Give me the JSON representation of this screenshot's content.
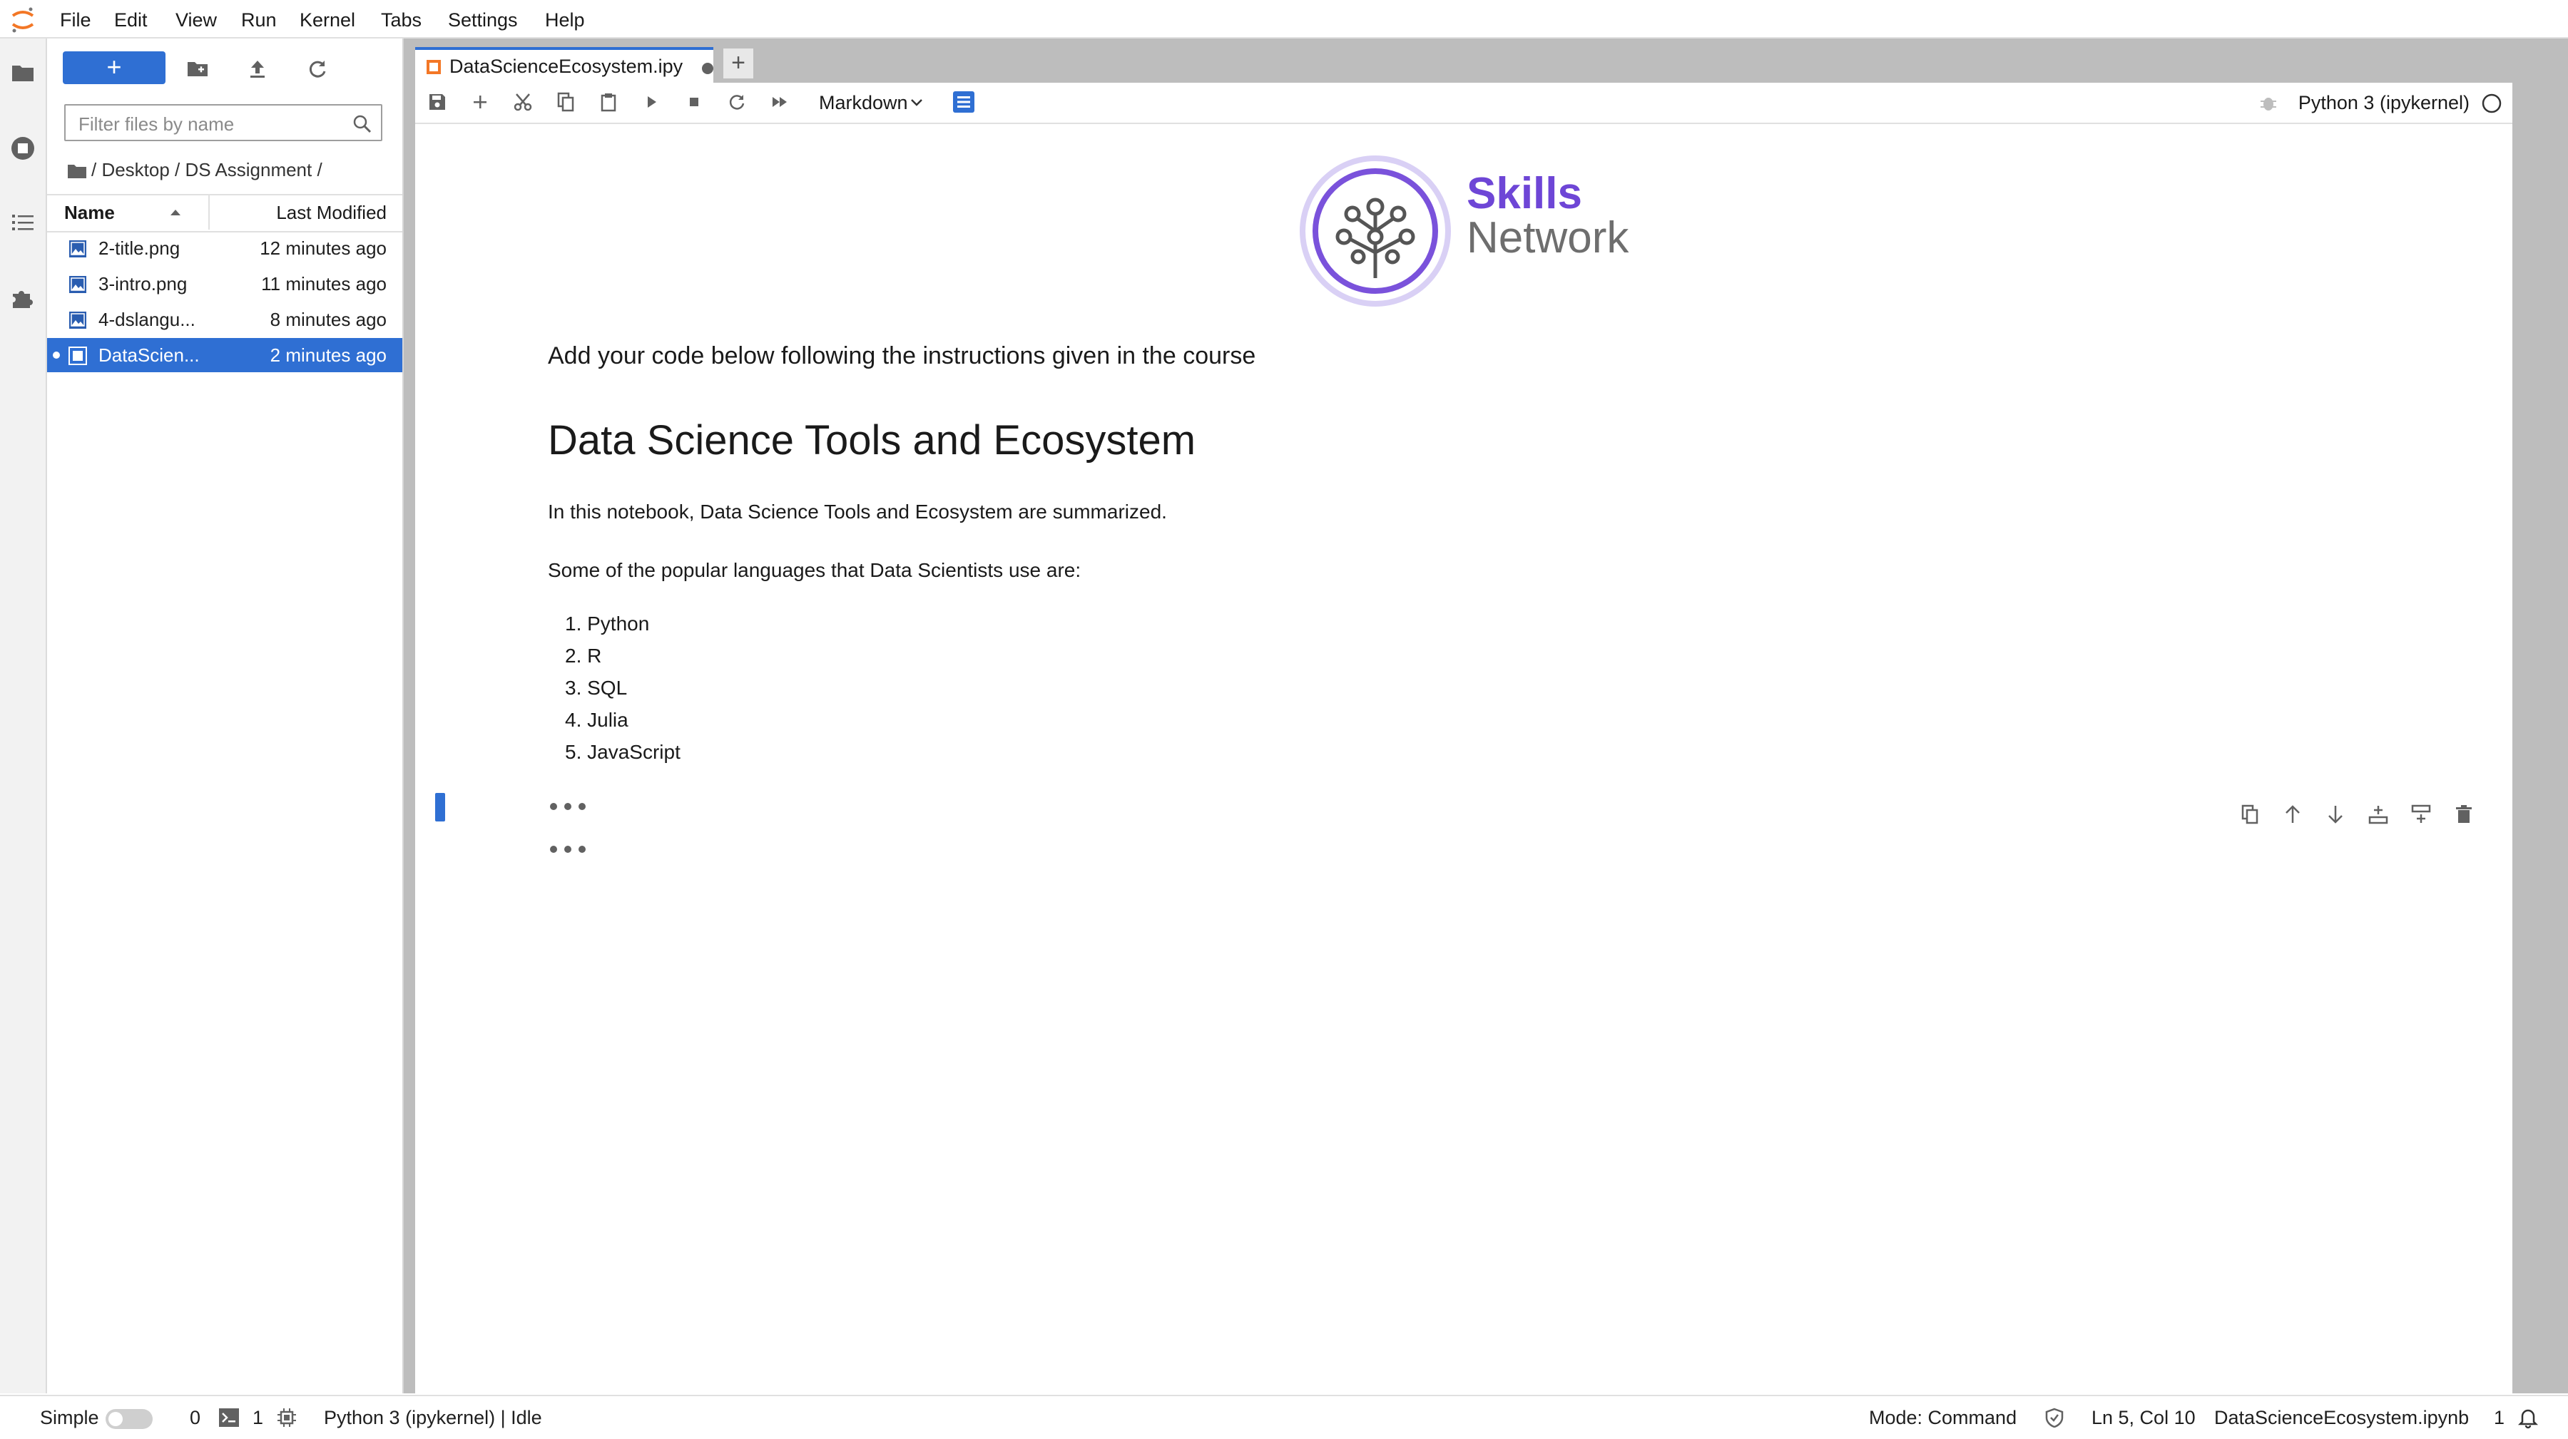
{
  "menu": {
    "items": [
      "File",
      "Edit",
      "View",
      "Run",
      "Kernel",
      "Tabs",
      "Settings",
      "Help"
    ]
  },
  "activity": {
    "icons": [
      "folder-icon",
      "running-icon",
      "toc-icon",
      "extension-icon"
    ]
  },
  "filebrowser": {
    "new_label": "+",
    "filter_placeholder": "Filter files by name",
    "breadcrumb": "/ Desktop / DS Assignment /",
    "col_name": "Name",
    "col_modified": "Last Modified",
    "files": [
      {
        "name": "2-title.png",
        "modified": "12 minutes ago"
      },
      {
        "name": "3-intro.png",
        "modified": "11 minutes ago"
      },
      {
        "name": "4-dslangu...",
        "modified": "8 minutes ago"
      },
      {
        "name": "DataScien...",
        "modified": "2 minutes ago"
      }
    ]
  },
  "tab": {
    "title": "DataScienceEcosystem.ipy",
    "new_tab": "+"
  },
  "toolbar": {
    "cell_type": "Markdown",
    "kernel": "Python 3 (ipykernel)"
  },
  "notebook": {
    "logo_word1": "Skills",
    "logo_word2": "Network",
    "instruction": "Add your code below following the instructions given in the course",
    "heading": "Data Science Tools and Ecosystem",
    "intro": "In this notebook, Data Science Tools and Ecosystem are summarized.",
    "languages_intro": "Some of the popular languages that Data Scientists use are:",
    "languages": [
      "1. Python",
      "2. R",
      "3. SQL",
      "4. Julia",
      "5. JavaScript"
    ]
  },
  "status": {
    "mode_simple": "Simple",
    "terminals": "0",
    "kernels": "1",
    "kernel_status": "Python 3 (ipykernel) | Idle",
    "mode": "Mode: Command",
    "cursor": "Ln 5, Col 10",
    "filename": "DataScienceEcosystem.ipynb",
    "notifications": "1"
  },
  "colors": {
    "accent": "#2f6fd3",
    "brand_purple": "#6e46d6",
    "jupyter_orange": "#f37726"
  }
}
